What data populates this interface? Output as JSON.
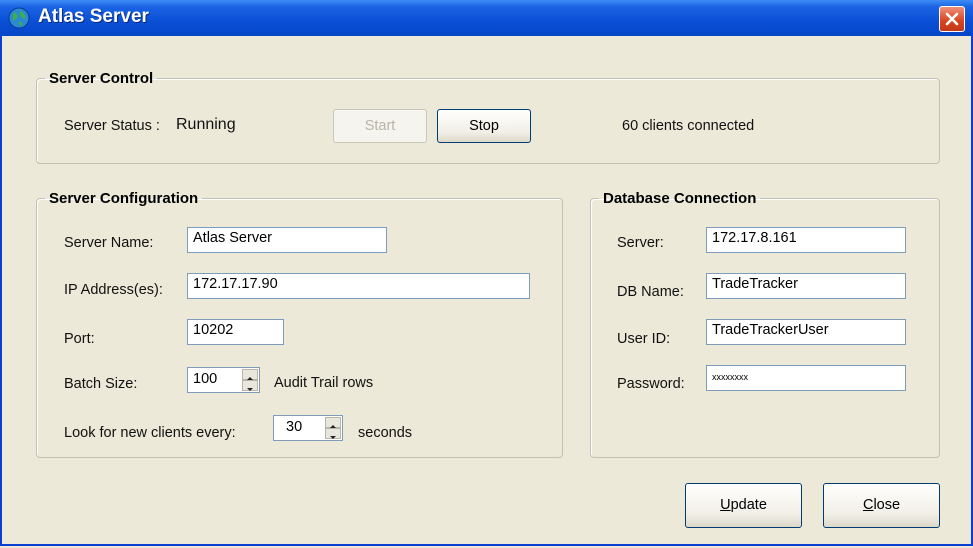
{
  "window": {
    "title": "Atlas Server",
    "icon": "globe-icon",
    "close_icon": "close-icon"
  },
  "server_control": {
    "legend": "Server Control",
    "status_label": "Server Status :",
    "status_value": "Running",
    "start_label": "Start",
    "stop_label": "Stop",
    "clients_text": "60 clients connected"
  },
  "server_config": {
    "legend": "Server Configuration",
    "name_label": "Server Name:",
    "name_value": "Atlas Server",
    "ip_label": "IP Address(es):",
    "ip_value": "172.17.17.90",
    "port_label": "Port:",
    "port_value": "10202",
    "batch_label": "Batch Size:",
    "batch_value": "100",
    "batch_suffix": "Audit Trail rows",
    "poll_label": "Look for new clients every:",
    "poll_value": "30",
    "poll_suffix": "seconds"
  },
  "db_connection": {
    "legend": "Database Connection",
    "server_label": "Server:",
    "server_value": "172.17.8.161",
    "dbname_label": "DB Name:",
    "dbname_value": "TradeTracker",
    "userid_label": "User ID:",
    "userid_value": "TradeTrackerUser",
    "password_label": "Password:",
    "password_value": "xxxxxxxx"
  },
  "footer": {
    "update_accel": "U",
    "update_rest": "pdate",
    "close_accel": "C",
    "close_rest": "lose"
  }
}
